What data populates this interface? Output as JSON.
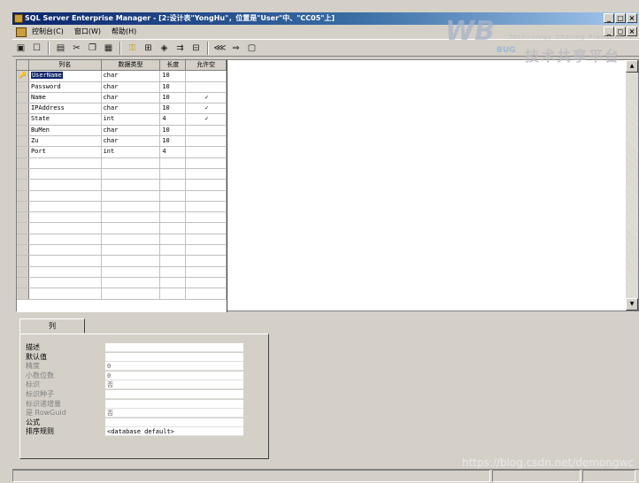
{
  "window": {
    "title": "SQL Server Enterprise Manager - [2:设计表\"YongHu\"，位置是\"User\"中、\"CC05\"上]",
    "min_label": "_",
    "max_label": "□",
    "close_label": "×"
  },
  "menu": {
    "items": [
      "控制台(C)",
      "窗口(W)",
      "帮助(H)"
    ],
    "mdi_min": "_",
    "mdi_restore": "◻",
    "mdi_close": "×"
  },
  "toolbar": {
    "icons": [
      "save-icon",
      "properties-icon",
      "insert-column-icon",
      "cut-icon",
      "copy-icon",
      "paste-icon",
      "primary-key-icon",
      "relationships-icon",
      "manage-indexes-icon",
      "manage-constraints-icon",
      "manage-triggers-icon",
      "generate-script-icon",
      "permissions-icon",
      "table-view-icon"
    ]
  },
  "grid": {
    "headers": {
      "name": "列名",
      "type": "数据类型",
      "length": "长度",
      "nullable": "允许空"
    },
    "rows": [
      {
        "name": "UserName",
        "type": "char",
        "length": "10",
        "nullable": "",
        "key": "🔑"
      },
      {
        "name": "Password",
        "type": "char",
        "length": "10",
        "nullable": ""
      },
      {
        "name": "Name",
        "type": "char",
        "length": "10",
        "nullable": "✓"
      },
      {
        "name": "IPAddress",
        "type": "char",
        "length": "10",
        "nullable": "✓"
      },
      {
        "name": "State",
        "type": "int",
        "length": "4",
        "nullable": "✓"
      },
      {
        "name": "BuMen",
        "type": "char",
        "length": "10",
        "nullable": ""
      },
      {
        "name": "Zu",
        "type": "char",
        "length": "10",
        "nullable": ""
      },
      {
        "name": "Port",
        "type": "int",
        "length": "4",
        "nullable": ""
      }
    ],
    "empty_rows": 13,
    "scroll_up": "▲",
    "scroll_down": "▼"
  },
  "properties": {
    "tab_label": "列",
    "rows": [
      {
        "label": "描述",
        "value": "",
        "dim": false
      },
      {
        "label": "默认值",
        "value": "",
        "dim": false
      },
      {
        "label": "精度",
        "value": "0",
        "dim": true
      },
      {
        "label": "小数位数",
        "value": "0",
        "dim": true
      },
      {
        "label": "标识",
        "value": "否",
        "dim": true
      },
      {
        "label": "标识种子",
        "value": "",
        "dim": true
      },
      {
        "label": "标识递增量",
        "value": "",
        "dim": true
      },
      {
        "label": "是 RowGuid",
        "value": "否",
        "dim": true
      },
      {
        "label": "公式",
        "value": "",
        "dim": false
      },
      {
        "label": "排序规则",
        "value": "<database default>",
        "dim": false
      }
    ]
  },
  "watermark": {
    "logo": "WB",
    "bug": "BUG",
    "tagline": "Technology Sharing Platform",
    "cn": "技术共享平台"
  },
  "credit": "https://blog.csdn.net/demongwc"
}
